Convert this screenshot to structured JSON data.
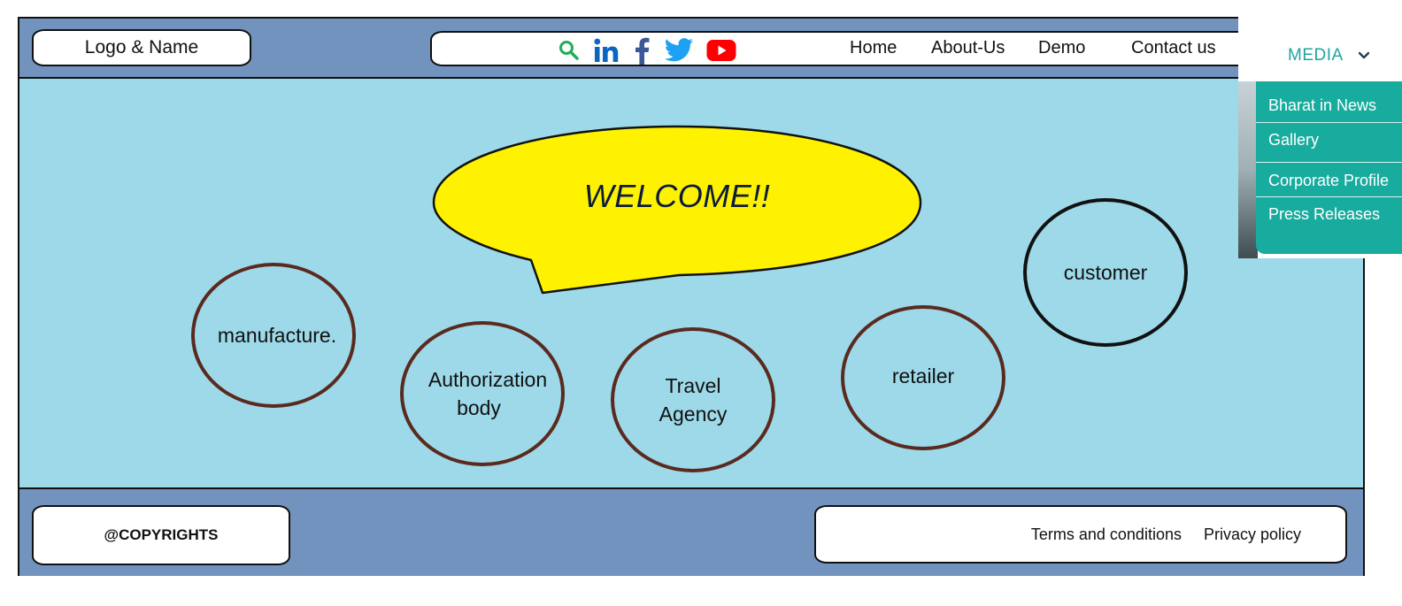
{
  "header": {
    "logo_text": "Logo & Name",
    "social_icons": [
      "search-icon",
      "linkedin-icon",
      "facebook-icon",
      "twitter-icon",
      "youtube-icon"
    ],
    "nav": [
      "Home",
      "About-Us",
      "Demo",
      "Contact us"
    ]
  },
  "main": {
    "welcome": "WELCOME!!",
    "circles": {
      "manufacture": "manufacture.",
      "authorization": [
        "Authorization",
        "body"
      ],
      "travel": [
        "Travel",
        "Agency"
      ],
      "retailer": "retailer",
      "customer": "customer"
    }
  },
  "footer": {
    "copyright": "@COPYRIGHTS",
    "terms": "Terms and conditions",
    "privacy": "Privacy policy"
  },
  "media_menu": {
    "title": "MEDIA",
    "items": [
      "Bharat in News",
      "Gallery",
      "Corporate Profile",
      "Press Releases"
    ]
  },
  "colors": {
    "header_bg": "#7293bd",
    "main_bg": "#9dd9e9",
    "bubble": "#fff200",
    "circle_border": "#5b2a1e",
    "menu_bg": "#18ac9e",
    "media_title": "#1fa5a0",
    "linkedin": "#0a66c2",
    "facebook": "#3b5998",
    "twitter": "#1da1f2",
    "youtube": "#ff0000",
    "search": "#1fae5a"
  }
}
